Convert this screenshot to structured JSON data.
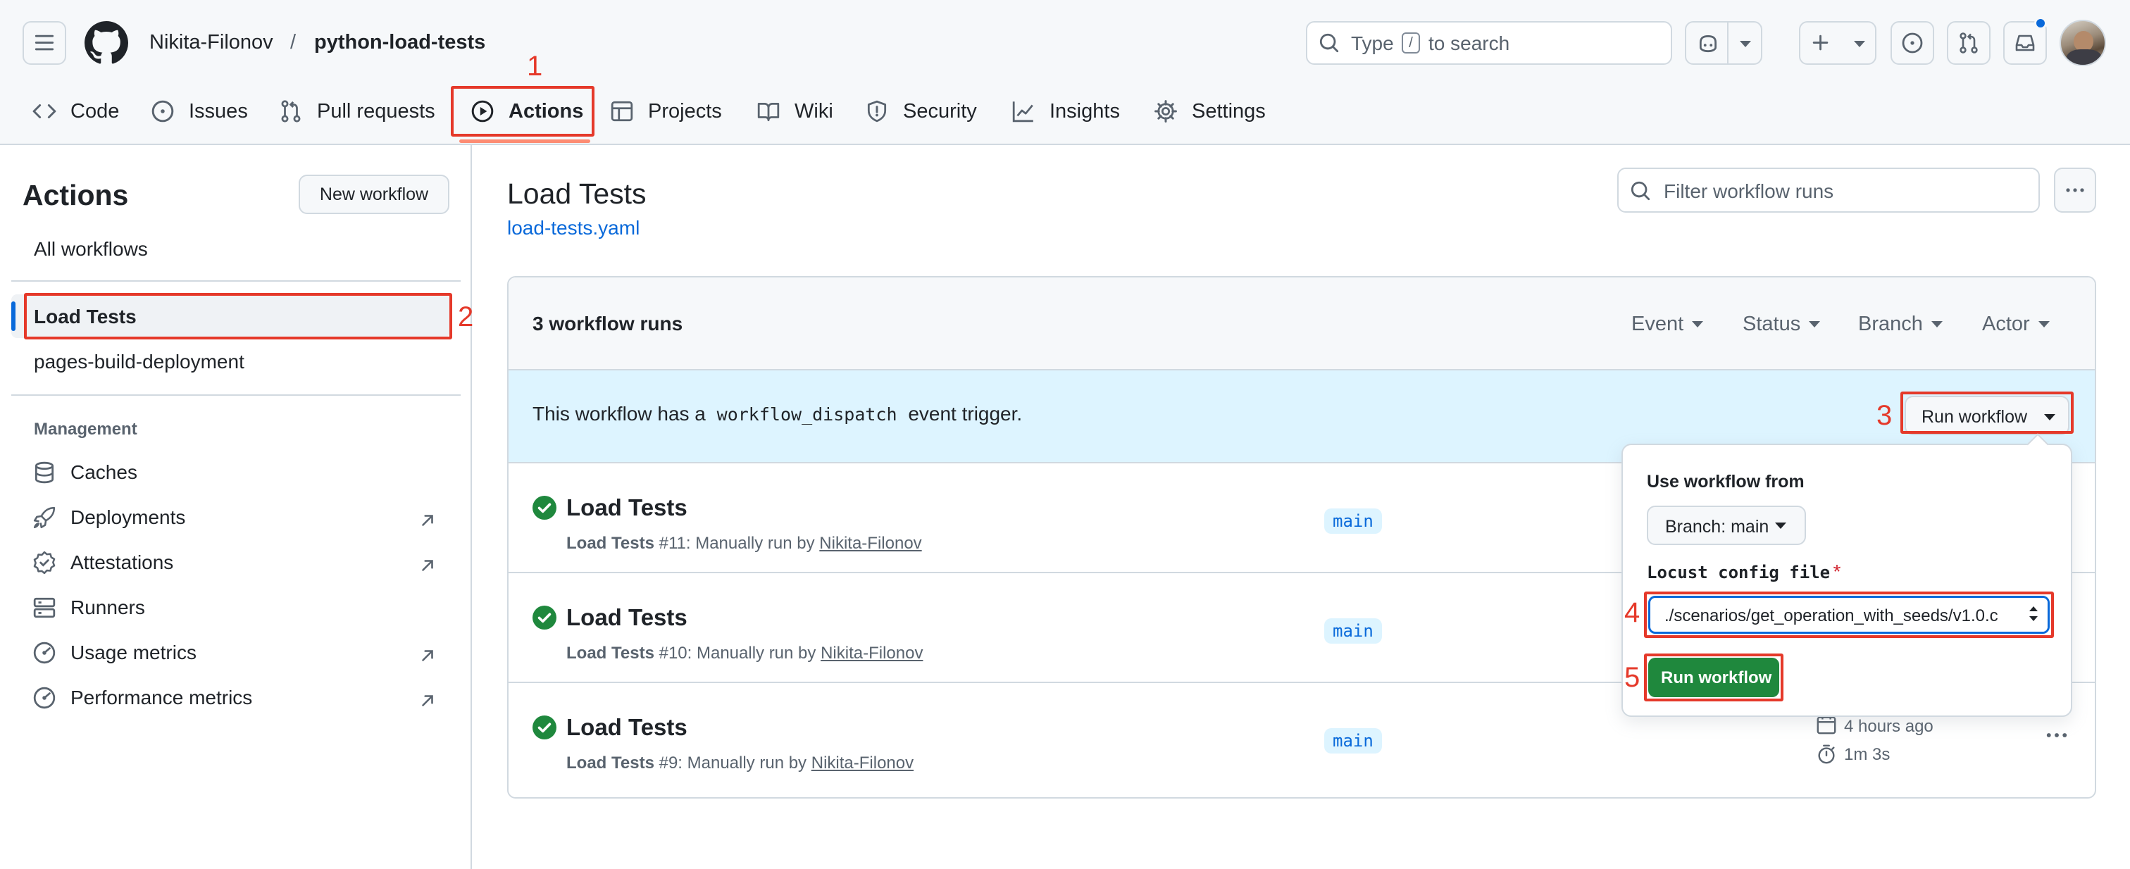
{
  "header": {
    "owner": "Nikita-Filonov",
    "separator": "/",
    "repo": "python-load-tests",
    "search_placeholder_before": "Type",
    "search_key": "/",
    "search_placeholder_after": "to search"
  },
  "tabs": [
    {
      "label": "Code",
      "icon": "code-icon"
    },
    {
      "label": "Issues",
      "icon": "issue-icon"
    },
    {
      "label": "Pull requests",
      "icon": "pull-request-icon"
    },
    {
      "label": "Actions",
      "icon": "play-icon"
    },
    {
      "label": "Projects",
      "icon": "table-icon"
    },
    {
      "label": "Wiki",
      "icon": "book-icon"
    },
    {
      "label": "Security",
      "icon": "shield-icon"
    },
    {
      "label": "Insights",
      "icon": "graph-icon"
    },
    {
      "label": "Settings",
      "icon": "gear-icon"
    }
  ],
  "sidebar": {
    "title": "Actions",
    "new_workflow": "New workflow",
    "all_workflows": "All workflows",
    "workflows": [
      "Load Tests",
      "pages-build-deployment"
    ],
    "management_heading": "Management",
    "management": [
      {
        "label": "Caches",
        "icon": "database-icon"
      },
      {
        "label": "Deployments",
        "icon": "rocket-icon"
      },
      {
        "label": "Attestations",
        "icon": "verified-icon"
      },
      {
        "label": "Runners",
        "icon": "server-icon"
      },
      {
        "label": "Usage metrics",
        "icon": "meter-icon"
      },
      {
        "label": "Performance metrics",
        "icon": "meter-icon"
      }
    ]
  },
  "main": {
    "title": "Load Tests",
    "file_link": "load-tests.yaml",
    "filter_placeholder": "Filter workflow runs",
    "runs_count": "3 workflow runs",
    "filters": [
      "Event",
      "Status",
      "Branch",
      "Actor"
    ],
    "dispatch_before": "This workflow has a",
    "dispatch_code": "workflow_dispatch",
    "dispatch_after": "event trigger.",
    "run_workflow_label": "Run workflow",
    "runs": [
      {
        "title": "Load Tests",
        "workflow": "Load Tests",
        "number": "#11",
        "desc": ": Manually run by",
        "user": "Nikita-Filonov",
        "branch": "main"
      },
      {
        "title": "Load Tests",
        "workflow": "Load Tests",
        "number": "#10",
        "desc": ": Manually run by",
        "user": "Nikita-Filonov",
        "branch": "main"
      },
      {
        "title": "Load Tests",
        "workflow": "Load Tests",
        "number": "#9",
        "desc": ": Manually run by",
        "user": "Nikita-Filonov",
        "branch": "main",
        "time_ago": "4 hours ago",
        "duration": "1m 3s"
      }
    ]
  },
  "popover": {
    "use_from": "Use workflow from",
    "branch_select": "Branch: main",
    "config_label": "Locust config file",
    "required_mark": "*",
    "config_value": "./scenarios/get_operation_with_seeds/v1.0.c",
    "submit": "Run workflow"
  },
  "annotations": [
    "1",
    "2",
    "3",
    "4",
    "5"
  ],
  "colors": {
    "accent_link": "#0969da",
    "success_green": "#1f883d",
    "annotation_red": "#e5392a",
    "dispatch_banner": "#ddf4ff",
    "notification_dot": "#0969da"
  }
}
